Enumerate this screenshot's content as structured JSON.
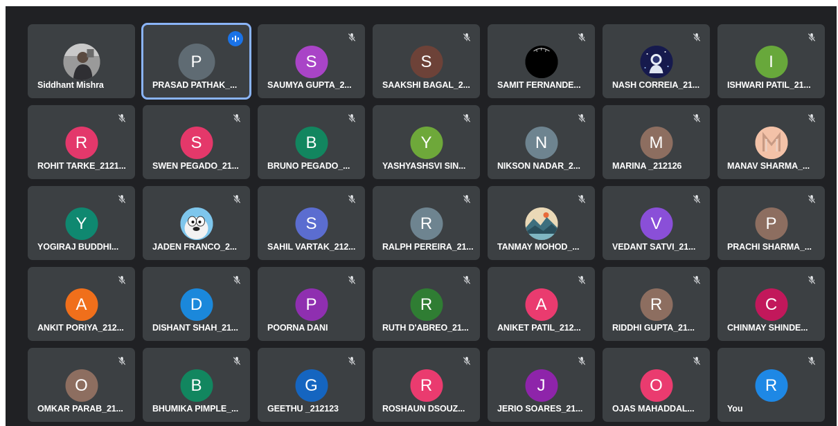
{
  "participants": [
    {
      "name": "Siddhant Mishra",
      "initial": "",
      "color": "#8d8d8d",
      "photo": "person-photo",
      "muted": false,
      "speaking": false
    },
    {
      "name": "PRASAD PATHAK_...",
      "initial": "P",
      "color": "#5f6b73",
      "photo": "",
      "muted": false,
      "speaking": true
    },
    {
      "name": "SAUMYA GUPTA_2...",
      "initial": "S",
      "color": "#a944c7",
      "photo": "",
      "muted": true,
      "speaking": false
    },
    {
      "name": "SAAKSHI BAGAL_2...",
      "initial": "S",
      "color": "#6d4238",
      "photo": "",
      "muted": true,
      "speaking": false
    },
    {
      "name": "SAMIT FERNANDE...",
      "initial": "",
      "color": "#000000",
      "photo": "dark-photo",
      "muted": true,
      "speaking": false
    },
    {
      "name": "NASH CORREIA_21...",
      "initial": "",
      "color": "#1b1f5e",
      "photo": "astronaut-photo",
      "muted": true,
      "speaking": false
    },
    {
      "name": "ISHWARI PATIL_21...",
      "initial": "I",
      "color": "#68a83b",
      "photo": "",
      "muted": true,
      "speaking": false
    },
    {
      "name": "ROHIT TARKE_2121...",
      "initial": "R",
      "color": "#e3386b",
      "photo": "",
      "muted": true,
      "speaking": false
    },
    {
      "name": "SWEN PEGADO_21...",
      "initial": "S",
      "color": "#e4386a",
      "photo": "",
      "muted": true,
      "speaking": false
    },
    {
      "name": "BRUNO PEGADO_...",
      "initial": "B",
      "color": "#12865f",
      "photo": "",
      "muted": true,
      "speaking": false
    },
    {
      "name": "YASHYASHSVI SIN...",
      "initial": "Y",
      "color": "#6ea83a",
      "photo": "",
      "muted": true,
      "speaking": false
    },
    {
      "name": "NIKSON NADAR_2...",
      "initial": "N",
      "color": "#6e8490",
      "photo": "",
      "muted": true,
      "speaking": false
    },
    {
      "name": "MARINA _212126",
      "initial": "M",
      "color": "#8d6e60",
      "photo": "",
      "muted": true,
      "speaking": false
    },
    {
      "name": "MANAV SHARMA_...",
      "initial": "",
      "color": "#f0b79a",
      "photo": "m-logo-photo",
      "muted": true,
      "speaking": false
    },
    {
      "name": "YOGIRAJ BUDDHI...",
      "initial": "Y",
      "color": "#0f8870",
      "photo": "",
      "muted": true,
      "speaking": false
    },
    {
      "name": "JADEN FRANCO_2...",
      "initial": "",
      "color": "#7ac3e8",
      "photo": "cartoon-photo",
      "muted": true,
      "speaking": false
    },
    {
      "name": "SAHIL VARTAK_212...",
      "initial": "S",
      "color": "#5b6dd0",
      "photo": "",
      "muted": true,
      "speaking": false
    },
    {
      "name": "RALPH PEREIRA_21...",
      "initial": "R",
      "color": "#6e8490",
      "photo": "",
      "muted": true,
      "speaking": false
    },
    {
      "name": "TANMAY MOHOD_...",
      "initial": "",
      "color": "#e9d8b5",
      "photo": "landscape-photo",
      "muted": true,
      "speaking": false
    },
    {
      "name": "VEDANT SATVI_21...",
      "initial": "V",
      "color": "#8a4fd8",
      "photo": "",
      "muted": true,
      "speaking": false
    },
    {
      "name": "PRACHI SHARMA_...",
      "initial": "P",
      "color": "#8d6e60",
      "photo": "",
      "muted": true,
      "speaking": false
    },
    {
      "name": "ANKIT PORIYA_212...",
      "initial": "A",
      "color": "#f06f1b",
      "photo": "",
      "muted": true,
      "speaking": false
    },
    {
      "name": "DISHANT SHAH_21...",
      "initial": "D",
      "color": "#1b88db",
      "photo": "",
      "muted": true,
      "speaking": false
    },
    {
      "name": "POORNA DANI",
      "initial": "P",
      "color": "#8f2fb0",
      "photo": "",
      "muted": true,
      "speaking": false
    },
    {
      "name": "RUTH D'ABREO_21...",
      "initial": "R",
      "color": "#2f7d33",
      "photo": "",
      "muted": true,
      "speaking": false
    },
    {
      "name": "ANIKET PATIL_212...",
      "initial": "A",
      "color": "#ea3b6f",
      "photo": "",
      "muted": true,
      "speaking": false
    },
    {
      "name": "RIDDHI GUPTA_21...",
      "initial": "R",
      "color": "#8d6e60",
      "photo": "",
      "muted": true,
      "speaking": false
    },
    {
      "name": "CHINMAY SHINDE...",
      "initial": "C",
      "color": "#c2185b",
      "photo": "",
      "muted": true,
      "speaking": false
    },
    {
      "name": "OMKAR PARAB_21...",
      "initial": "O",
      "color": "#8d6e60",
      "photo": "",
      "muted": true,
      "speaking": false
    },
    {
      "name": "BHUMIKA PIMPLE_...",
      "initial": "B",
      "color": "#12865f",
      "photo": "",
      "muted": true,
      "speaking": false
    },
    {
      "name": "GEETHU _212123",
      "initial": "G",
      "color": "#1565c0",
      "photo": "",
      "muted": true,
      "speaking": false
    },
    {
      "name": "ROSHAUN DSOUZ...",
      "initial": "R",
      "color": "#ea3b6f",
      "photo": "",
      "muted": true,
      "speaking": false
    },
    {
      "name": "JERIO SOARES_21...",
      "initial": "J",
      "color": "#8e24aa",
      "photo": "",
      "muted": true,
      "speaking": false
    },
    {
      "name": "OJAS MAHADDAL...",
      "initial": "O",
      "color": "#ea3b6f",
      "photo": "",
      "muted": true,
      "speaking": false
    },
    {
      "name": "You",
      "initial": "R",
      "color": "#1e88e5",
      "photo": "",
      "muted": true,
      "speaking": false
    }
  ]
}
